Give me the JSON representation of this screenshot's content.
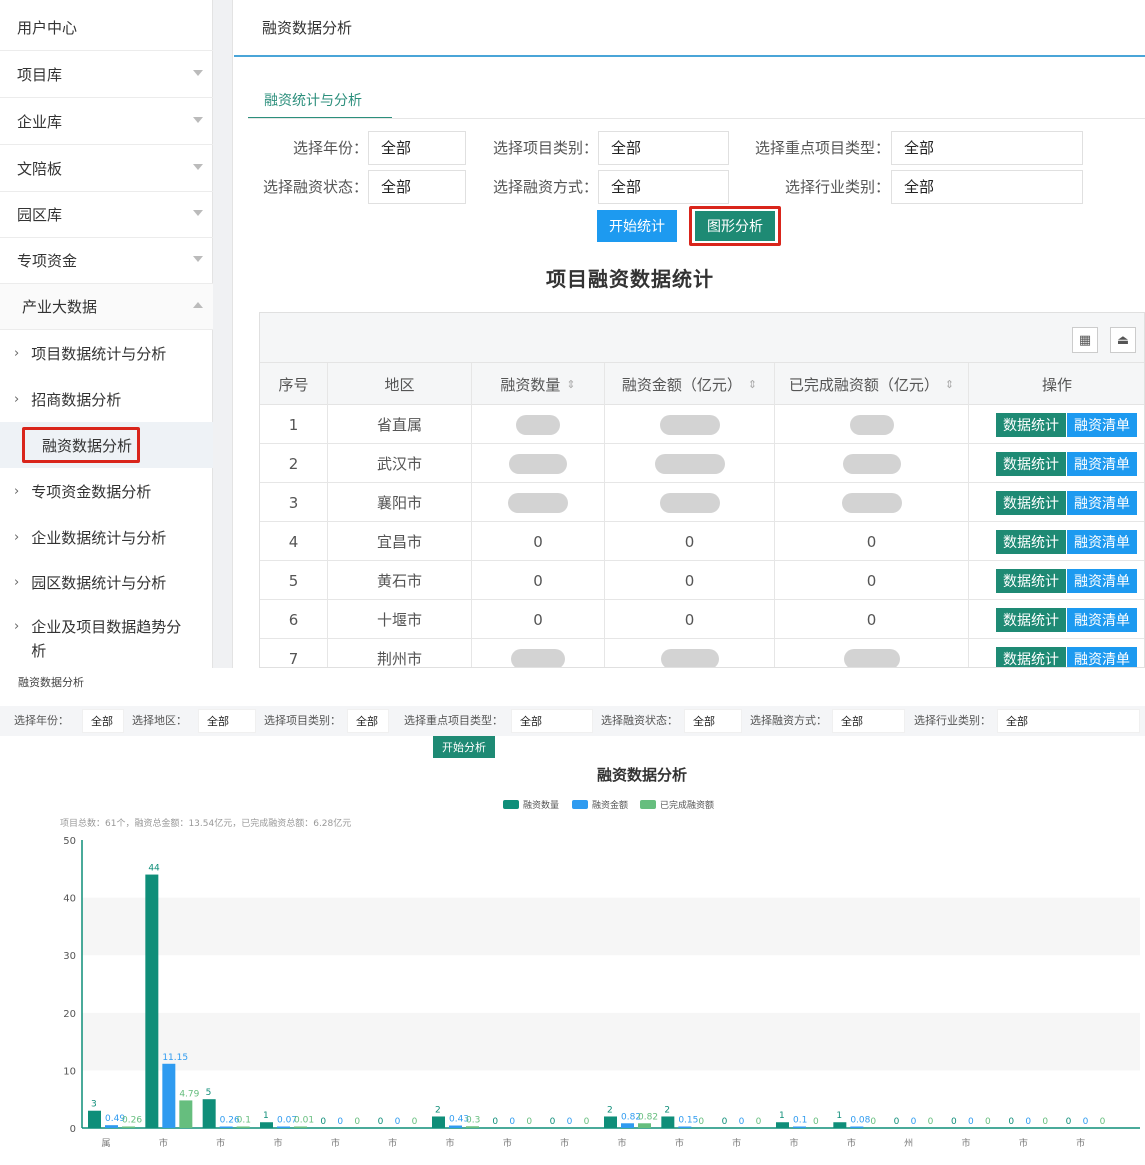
{
  "sidebar": {
    "items": [
      {
        "label": "用户中心",
        "chevron": "none"
      },
      {
        "label": "项目库",
        "chevron": "down"
      },
      {
        "label": "企业库",
        "chevron": "down"
      },
      {
        "label": "文陪板",
        "chevron": "down"
      },
      {
        "label": "园区库",
        "chevron": "down"
      },
      {
        "label": "专项资金",
        "chevron": "down"
      },
      {
        "label": "产业大数据",
        "chevron": "up"
      }
    ],
    "subitems": [
      {
        "label": "项目数据统计与分析"
      },
      {
        "label": "招商数据分析"
      },
      {
        "label": "融资数据分析",
        "active": true
      },
      {
        "label": "专项资金数据分析"
      },
      {
        "label": "企业数据统计与分析"
      },
      {
        "label": "园区数据统计与分析"
      },
      {
        "label": "企业及项目数据趋势分析"
      }
    ]
  },
  "header": {
    "title": "融资数据分析"
  },
  "tab": {
    "label": "融资统计与分析"
  },
  "filters": {
    "year_label": "选择年份：",
    "year_value": "全部",
    "type_label": "选择项目类别：",
    "type_value": "全部",
    "key_label": "选择重点项目类型：",
    "key_value": "全部",
    "status_label": "选择融资状态：",
    "status_value": "全部",
    "method_label": "选择融资方式：",
    "method_value": "全部",
    "industry_label": "选择行业类别：",
    "industry_value": "全部"
  },
  "buttons": {
    "start": "开始统计",
    "graph": "图形分析"
  },
  "table": {
    "title": "项目融资数据统计",
    "headers": [
      "序号",
      "地区",
      "融资数量",
      "融资金额（亿元）",
      "已完成融资额（亿元）",
      "操作"
    ],
    "rows": [
      {
        "idx": "1",
        "region": "省直属",
        "count": "",
        "amount": "",
        "done": "",
        "blurred": true
      },
      {
        "idx": "2",
        "region": "武汉市",
        "count": "",
        "amount": "",
        "done": "",
        "blurred": true
      },
      {
        "idx": "3",
        "region": "襄阳市",
        "count": "",
        "amount": "",
        "done": "",
        "blurred": true
      },
      {
        "idx": "4",
        "region": "宜昌市",
        "count": "0",
        "amount": "0",
        "done": "0",
        "blurred": false
      },
      {
        "idx": "5",
        "region": "黄石市",
        "count": "0",
        "amount": "0",
        "done": "0",
        "blurred": false
      },
      {
        "idx": "6",
        "region": "十堰市",
        "count": "0",
        "amount": "0",
        "done": "0",
        "blurred": false
      },
      {
        "idx": "7",
        "region": "荆州市",
        "count": "",
        "amount": "",
        "done": "",
        "blurred": true
      }
    ],
    "action_stats": "数据统计",
    "action_list": "融资清单"
  },
  "bottom": {
    "title": "融资数据分析",
    "filters": [
      {
        "label": "选择年份：",
        "value": "全部"
      },
      {
        "label": "选择地区：",
        "value": "全部"
      },
      {
        "label": "选择项目类别：",
        "value": "全部"
      },
      {
        "label": "选择重点项目类型：",
        "value": "全部"
      },
      {
        "label": "选择融资状态：",
        "value": "全部"
      },
      {
        "label": "选择融资方式：",
        "value": "全部"
      },
      {
        "label": "选择行业类别：",
        "value": "全部"
      }
    ],
    "start_button": "开始分析"
  },
  "colors": {
    "count": "#0f8e79",
    "amount": "#2f9bf0",
    "done": "#66be7e",
    "accent": "#1e8a74"
  },
  "chart_data": {
    "type": "bar",
    "title": "融资数据分析",
    "summary": "项目总数：61个，融资总金额：13.54亿元，已完成融资总额：6.28亿元",
    "ylim": [
      0,
      50
    ],
    "yticks": [
      0,
      10,
      20,
      30,
      40,
      50
    ],
    "legend_position": "top-center",
    "categories": [
      "属",
      "市",
      "市",
      "市",
      "市",
      "市",
      "市",
      "市",
      "市",
      "市",
      "市",
      "市",
      "市",
      "市",
      "州",
      "市",
      "市",
      "市"
    ],
    "series": [
      {
        "name": "融资数量",
        "values": [
          3,
          44,
          5,
          1,
          0,
          0,
          2,
          0,
          0,
          2,
          2,
          0,
          1,
          1,
          0,
          0,
          0,
          0
        ],
        "labels": [
          "3",
          "44",
          "5",
          "1",
          "0",
          "0",
          "2",
          "0",
          "0",
          "2",
          "2",
          "0",
          "1",
          "1",
          "0",
          "0",
          "0",
          "0"
        ]
      },
      {
        "name": "融资金额",
        "values": [
          0.49,
          11.15,
          0.26,
          0.07,
          0,
          0,
          0.43,
          0,
          0,
          0.82,
          0.15,
          0,
          0.1,
          0.08,
          0,
          0,
          0,
          0
        ],
        "labels": [
          "0.49",
          "11.15",
          "0.26",
          "0.07",
          "0",
          "0",
          "0.43",
          "0",
          "0",
          "0.82",
          "0.15",
          "0",
          "0.1",
          "0.08",
          "0",
          "0",
          "0",
          "0"
        ]
      },
      {
        "name": "已完成融资额",
        "values": [
          0.26,
          4.79,
          0.1,
          0.01,
          0,
          0,
          0.3,
          0,
          0,
          0.82,
          0,
          0,
          0,
          0,
          0,
          0,
          0,
          0
        ],
        "labels": [
          "0.26",
          "4.79",
          "0.1",
          "0.01",
          "0",
          "0",
          "0.3",
          "0",
          "0",
          "0.82",
          "0",
          "0",
          "0",
          "0",
          "0",
          "0",
          "0",
          "0"
        ]
      }
    ]
  }
}
